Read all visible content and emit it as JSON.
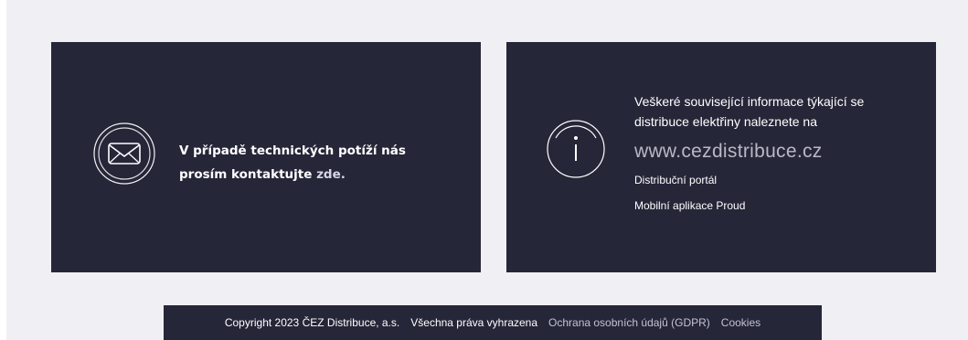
{
  "contact": {
    "text_before": "V případě technických potíží nás prosím kontaktujte",
    "link_label": "zde."
  },
  "info": {
    "text": "Veškeré související informace týkající se distribuce elektřiny naleznete na",
    "url_label": "www.cezdistribuce.cz",
    "links": [
      "Distribuční portál",
      "Mobilní aplikace Proud"
    ]
  },
  "footer": {
    "copyright": "Copyright 2023 ČEZ Distribuce, a.s.",
    "rights": "Všechna práva vyhrazena",
    "gdpr": "Ochrana osobních údajů (GDPR)",
    "cookies": "Cookies"
  },
  "colors": {
    "panel_bg": "#252638",
    "page_bg": "#f0eff3",
    "text": "#ffffff",
    "muted": "#b9b8c7"
  },
  "icons": [
    "mail-icon",
    "info-icon"
  ]
}
